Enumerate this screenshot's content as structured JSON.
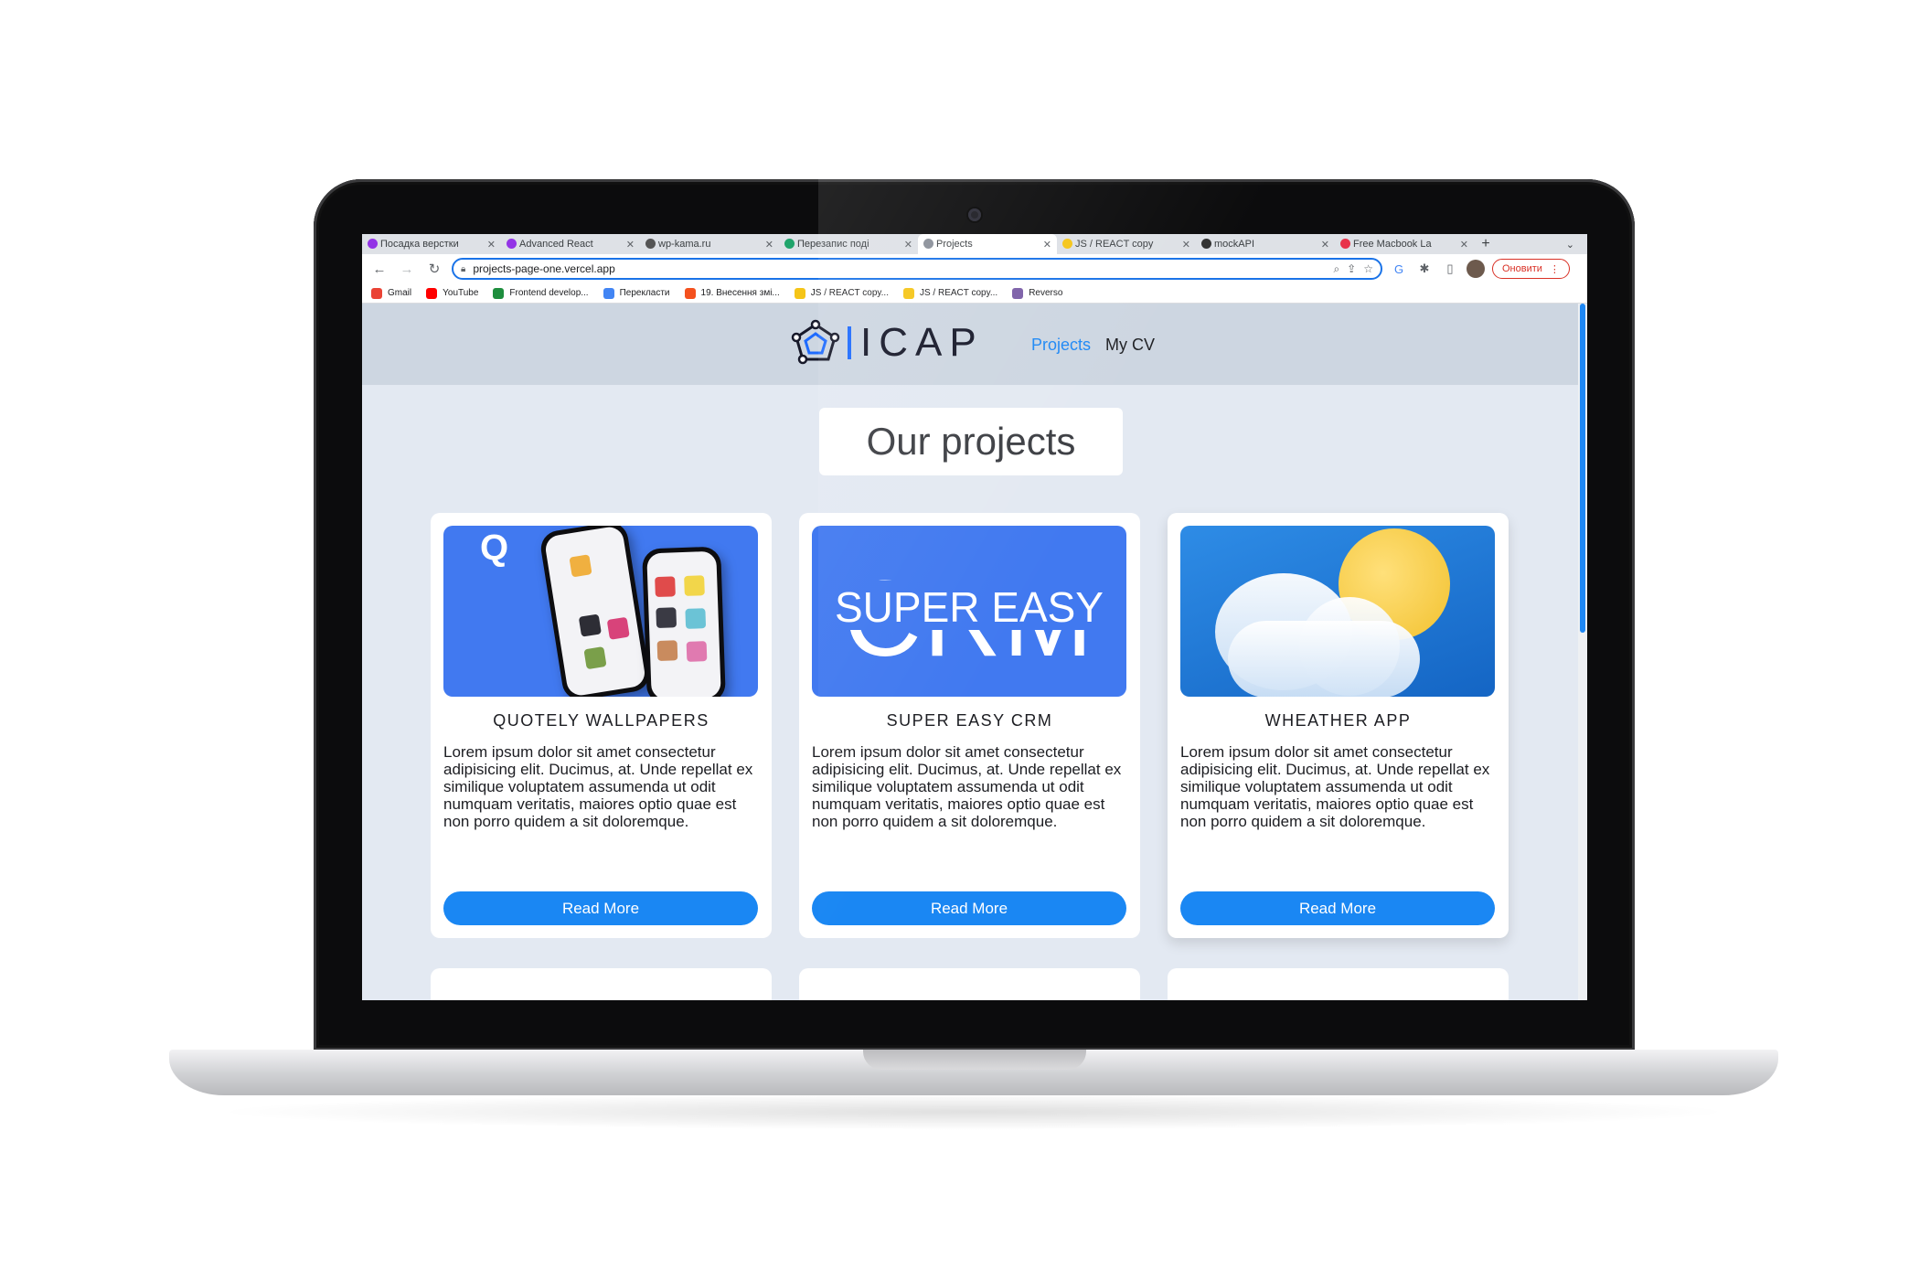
{
  "browser": {
    "tabs": [
      {
        "title": "Посадка верстки",
        "color": "#9334e6"
      },
      {
        "title": "Advanced React",
        "color": "#9334e6"
      },
      {
        "title": "wp-kama.ru",
        "color": "#555555"
      },
      {
        "title": "Перезапис поді",
        "color": "#20a46b"
      },
      {
        "title": "Projects",
        "color": "#8a8f99"
      },
      {
        "title": "JS / REACT copy",
        "color": "#f5c518"
      },
      {
        "title": "mockAPI",
        "color": "#333333"
      },
      {
        "title": "Free Macbook La",
        "color": "#e8334a"
      }
    ],
    "url": "projects-page-one.vercel.app",
    "update_label": "Оновити",
    "bookmarks": [
      {
        "label": "Gmail",
        "color": "#ea4335"
      },
      {
        "label": "YouTube",
        "color": "#ff0000"
      },
      {
        "label": "Frontend develop...",
        "color": "#1e8e3e"
      },
      {
        "label": "Перекласти",
        "color": "#4285f4"
      },
      {
        "label": "19. Внесення змі...",
        "color": "#f4511e"
      },
      {
        "label": "JS / REACT copy...",
        "color": "#f5c518"
      },
      {
        "label": "JS / REACT copy...",
        "color": "#f5c518"
      },
      {
        "label": "Reverso",
        "color": "#7b5ea7"
      }
    ]
  },
  "site": {
    "logo_text": "ICAP",
    "nav": {
      "projects": "Projects",
      "cv": "My CV"
    },
    "page_title": "Our projects",
    "accent_color": "#1a87f3",
    "cards": [
      {
        "title": "QUOTELY WALLPAPERS",
        "description": "Lorem ipsum dolor sit amet consectetur adipisicing elit. Ducimus, at. Unde repellat ex similique voluptatem assumenda ut odit numquam veritatis, maiores optio quae est non porro quidem a sit doloremque.",
        "button": "Read More"
      },
      {
        "title": "SUPER EASY CRM",
        "description": "Lorem ipsum dolor sit amet consectetur adipisicing elit. Ducimus, at. Unde repellat ex similique voluptatem assumenda ut odit numquam veritatis, maiores optio quae est non porro quidem a sit doloremque.",
        "button": "Read More",
        "image_text": {
          "top": "SUPER EASY",
          "bottom": "CRM"
        }
      },
      {
        "title": "WHEATHER APP",
        "description": "Lorem ipsum dolor sit amet consectetur adipisicing elit. Ducimus, at. Unde repellat ex similique voluptatem assumenda ut odit numquam veritatis, maiores optio quae est non porro quidem a sit doloremque.",
        "button": "Read More"
      }
    ]
  },
  "icons": {
    "back": "arrow-left-icon",
    "forward": "arrow-right-icon",
    "reload": "reload-icon",
    "lock": "lock-icon",
    "zoom": "zoom-icon",
    "share": "share-icon",
    "star": "star-icon",
    "translate": "translate-icon",
    "extensions": "puzzle-icon",
    "sidepanel": "side-panel-icon",
    "menu": "kebab-menu-icon"
  }
}
